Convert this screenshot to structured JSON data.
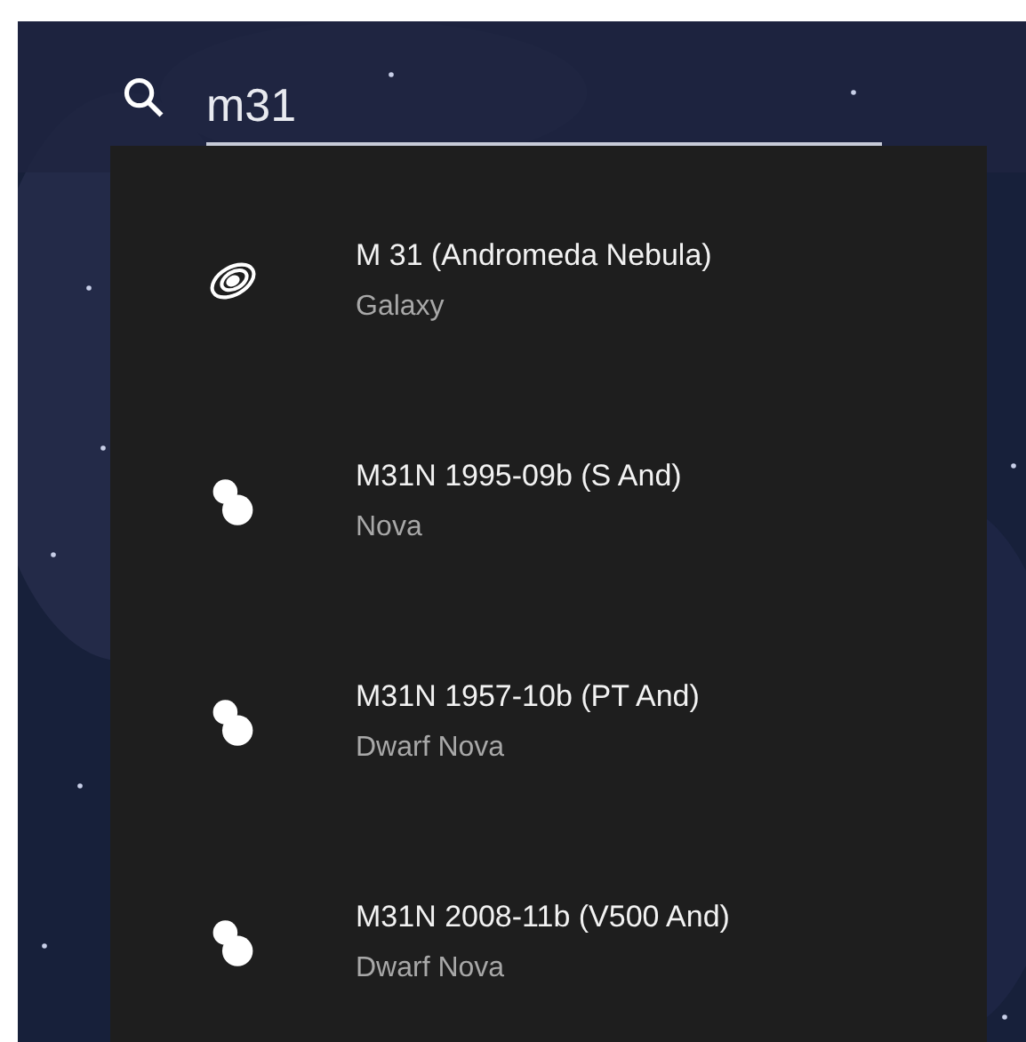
{
  "search": {
    "value": "m31"
  },
  "results": [
    {
      "kind": "galaxy",
      "name": "M 31 (Andromeda Nebula)",
      "type": "Galaxy"
    },
    {
      "kind": "star-pair",
      "name": "M31N 1995-09b (S And)",
      "type": "Nova"
    },
    {
      "kind": "star-pair",
      "name": "M31N 1957-10b (PT And)",
      "type": "Dwarf Nova"
    },
    {
      "kind": "star-pair",
      "name": "M31N 2008-11b (V500 And)",
      "type": "Dwarf Nova"
    }
  ]
}
